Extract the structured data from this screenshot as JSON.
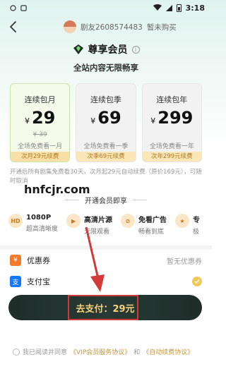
{
  "status_bar": {
    "time": "3:18"
  },
  "header": {
    "username": "剧友2608574483",
    "status": "暂未购买"
  },
  "vip": {
    "title": "尊享会员",
    "subtitle": "全站内容无限畅享"
  },
  "plans": [
    {
      "name": "连续包月",
      "currency": "¥",
      "price": "29",
      "original": "¥ 39",
      "desc": "全场免费看一月",
      "footer": "次月29元续费",
      "selected": true
    },
    {
      "name": "连续包季",
      "currency": "¥",
      "price": "69",
      "original": "",
      "desc": "全场免费看一季",
      "footer": "次季69元续费",
      "selected": false
    },
    {
      "name": "连续包年",
      "currency": "¥",
      "price": "299",
      "original": "",
      "desc": "全场免费看一年",
      "footer": "次年299元续费",
      "selected": false
    }
  ],
  "terms": "开通后所有剧集免费看30天，次月起29元自动续费（原价169元），可随时取消",
  "watermark": "hnfcjr.com",
  "privileges": {
    "title": "开通会员即享",
    "items": [
      {
        "icon": "hd-icon",
        "title": "1080P",
        "desc": "超高清晰度"
      },
      {
        "icon": "film-icon",
        "title": "高清片源",
        "desc": "无限观看"
      },
      {
        "icon": "no-ads-icon",
        "title": "免看广告",
        "desc": "畅看到底"
      },
      {
        "icon": "exclusive-icon",
        "title": "专",
        "desc": "极"
      }
    ]
  },
  "payment": {
    "coupon_label": "优惠券",
    "coupon_value": "暂无优惠券",
    "alipay_label": "支付宝"
  },
  "pay_button": {
    "label": "去支付：29元"
  },
  "agreement": {
    "prefix": "我已阅读并同意",
    "vip_link": "《VIP会员服务协议》",
    "and": "和",
    "renew_link": "《自动续费协议》"
  },
  "colors": {
    "accent_gold": "#f7d17a",
    "button_dark": "#1f2d29",
    "highlight_red": "#d23a3a"
  }
}
